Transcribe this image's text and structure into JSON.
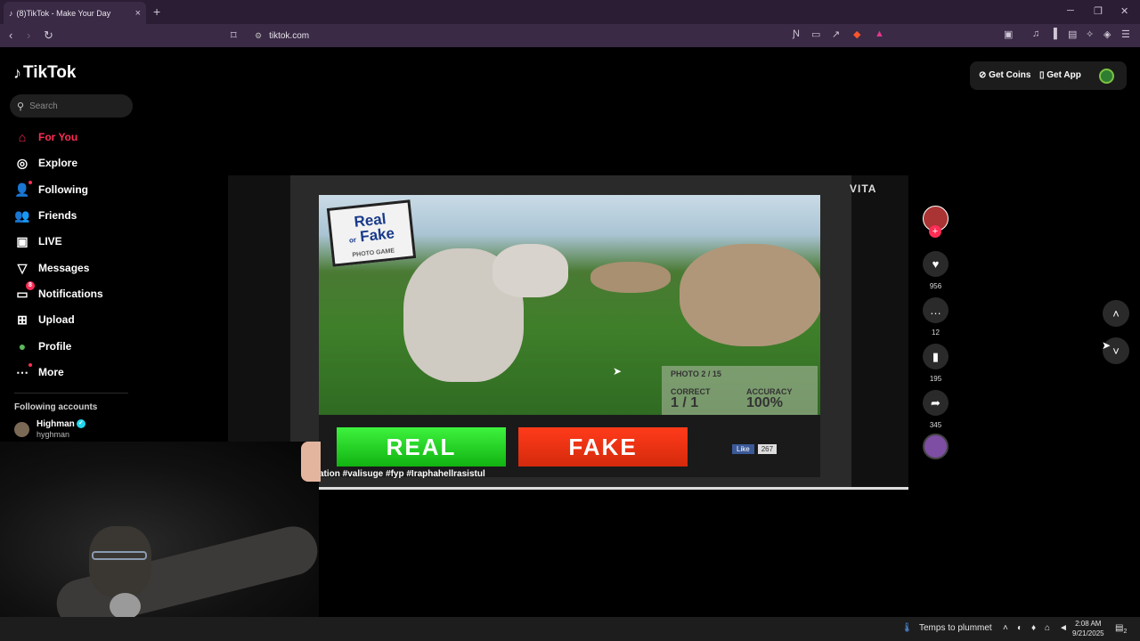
{
  "browser": {
    "tab_title": "(8)TikTok - Make Your Day",
    "tab_close": "×",
    "new_tab": "+",
    "url": "tiktok.com",
    "window": {
      "minimize": "─",
      "maximize": "❐",
      "close": "✕"
    }
  },
  "sidebar": {
    "logo": "TikTok",
    "search_placeholder": "Search",
    "items": [
      {
        "label": "For You",
        "icon": "⌂"
      },
      {
        "label": "Explore",
        "icon": "◎"
      },
      {
        "label": "Following",
        "icon": "👤"
      },
      {
        "label": "Friends",
        "icon": "👥"
      },
      {
        "label": "LIVE",
        "icon": "▣"
      },
      {
        "label": "Messages",
        "icon": "▽"
      },
      {
        "label": "Notifications",
        "icon": "▭",
        "badge": "8"
      },
      {
        "label": "Upload",
        "icon": "⊞"
      },
      {
        "label": "Profile",
        "icon": "●"
      },
      {
        "label": "More",
        "icon": "⋯"
      }
    ],
    "following_title": "Following accounts",
    "account": {
      "name": "Highman",
      "username": "hyghman",
      "verified": "✓"
    }
  },
  "header": {
    "get_coins": "Get Coins",
    "get_app": "Get App"
  },
  "video": {
    "watermark": "VITA",
    "game_logo_line1": "Real",
    "game_logo_line2": "or",
    "game_logo_line3": "Fake",
    "game_logo_sub": "PHOTO GAME",
    "photo_counter": "PHOTO 2 / 15",
    "correct_label": "CORRECT",
    "correct_value": "1 / 1",
    "accuracy_label": "ACCURACY",
    "accuracy_value": "100%",
    "real_button": "REAL",
    "fake_button": "FAKE",
    "fb_like": "Like",
    "fb_count": "267",
    "caption": "ation  #valisuge  #fyp  #Iraphahellrasistul",
    "progress_fraction": 1.0
  },
  "actions": {
    "likes": "956",
    "comments": "12",
    "saves": "195",
    "shares": "345"
  },
  "taskbar": {
    "weather": "Temps to plummet",
    "time": "2:08 AM",
    "date": "9/21/2025",
    "notif_count": "2"
  }
}
